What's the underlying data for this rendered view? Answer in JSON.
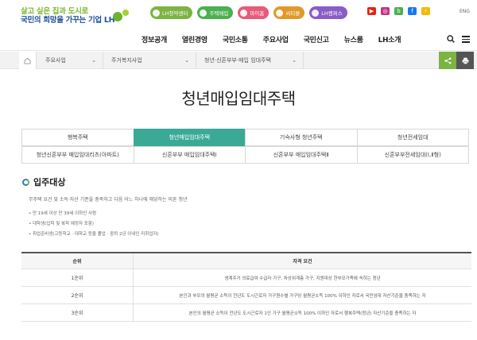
{
  "logo": {
    "line1": "살고 싶은 집과 도시로",
    "line2": "국민의 희망을 가꾸는 기업 LH",
    "brand_colors": [
      "#7bb82a",
      "#1e4fa0"
    ]
  },
  "quick_links": [
    {
      "label": "LH청약센터",
      "color": "#7cb342"
    },
    {
      "label": "주택매입",
      "color": "#4caf50"
    },
    {
      "label": "마이홈",
      "color": "#e65a7a"
    },
    {
      "label": "씨티몰",
      "color": "#e09a2a"
    },
    {
      "label": "LH캠퍼스",
      "color": "#8a5cc6"
    }
  ],
  "sns": [
    {
      "icon": "youtube-icon",
      "glyph": "▶",
      "color": "#e62117"
    },
    {
      "icon": "instagram-icon",
      "glyph": "◎",
      "color": "#c13584"
    },
    {
      "icon": "blog-icon",
      "glyph": "b",
      "color": "#4caf50"
    },
    {
      "icon": "facebook-icon",
      "glyph": "f",
      "color": "#1877f2"
    },
    {
      "icon": "lh-tube-icon",
      "glyph": "⚡",
      "color": "#f6b800"
    }
  ],
  "lang": "ENG",
  "gnb": {
    "items": [
      "정보공개",
      "열린경영",
      "국민소통",
      "주요사업",
      "국민신고",
      "뉴스룸",
      "LH소개"
    ]
  },
  "breadcrumb": {
    "level1": "주요사업",
    "level2": "주거복지사업",
    "level3": "청년·신혼부부·매입 임대주택"
  },
  "page_title": "청년매입임대주택",
  "tabs": {
    "row1": [
      "행복주택",
      "청년매입임대주택",
      "기숙사형 청년주택",
      "청년전세임대"
    ],
    "row2": [
      "청년신혼부부 매입임대리츠(아파트)",
      "신혼부부 매입임대주택Ⅰ",
      "신혼부부 매입임대주택Ⅱ",
      "신혼부부전세임대(Ⅰ,Ⅱ형)"
    ],
    "active": "청년매입임대주택"
  },
  "section": {
    "title": "입주대상",
    "description": "무주택 요건 및 소득·자산 기준을 충족하고 다음 어느 하나에 해당하는 미혼 청년",
    "bullets": [
      "만 19세 이상 만 39세 이하인 사람",
      "대학생(입학 및 복학 예정자 포함)",
      "취업준비생(고등학교 · 대학교 등을 졸업 · 중퇴 2년 이내인 미취업자)"
    ]
  },
  "table": {
    "headers": [
      "순위",
      "자격 요건"
    ],
    "rows": [
      {
        "rank": "1순위",
        "req": "생계주거 의료급여 수급자 가구, 차상위계층 가구, 지원대상 한부모가족에 속하는 청년"
      },
      {
        "rank": "2순위",
        "req": "본인과 부모의 월평균 소득이 전년도 도시근로자 가구원수별 가구당 월평균소득 100% 이하인 자로서 국민임대 자산기준을 충족하는 자"
      },
      {
        "rank": "3순위",
        "req": "본인의 월평균 소득이 전년도 도시근로자 1인 가구 월평균소득 100% 이하인 자로서 행복주택(청년) 자산기준을 충족하는 자"
      }
    ]
  }
}
